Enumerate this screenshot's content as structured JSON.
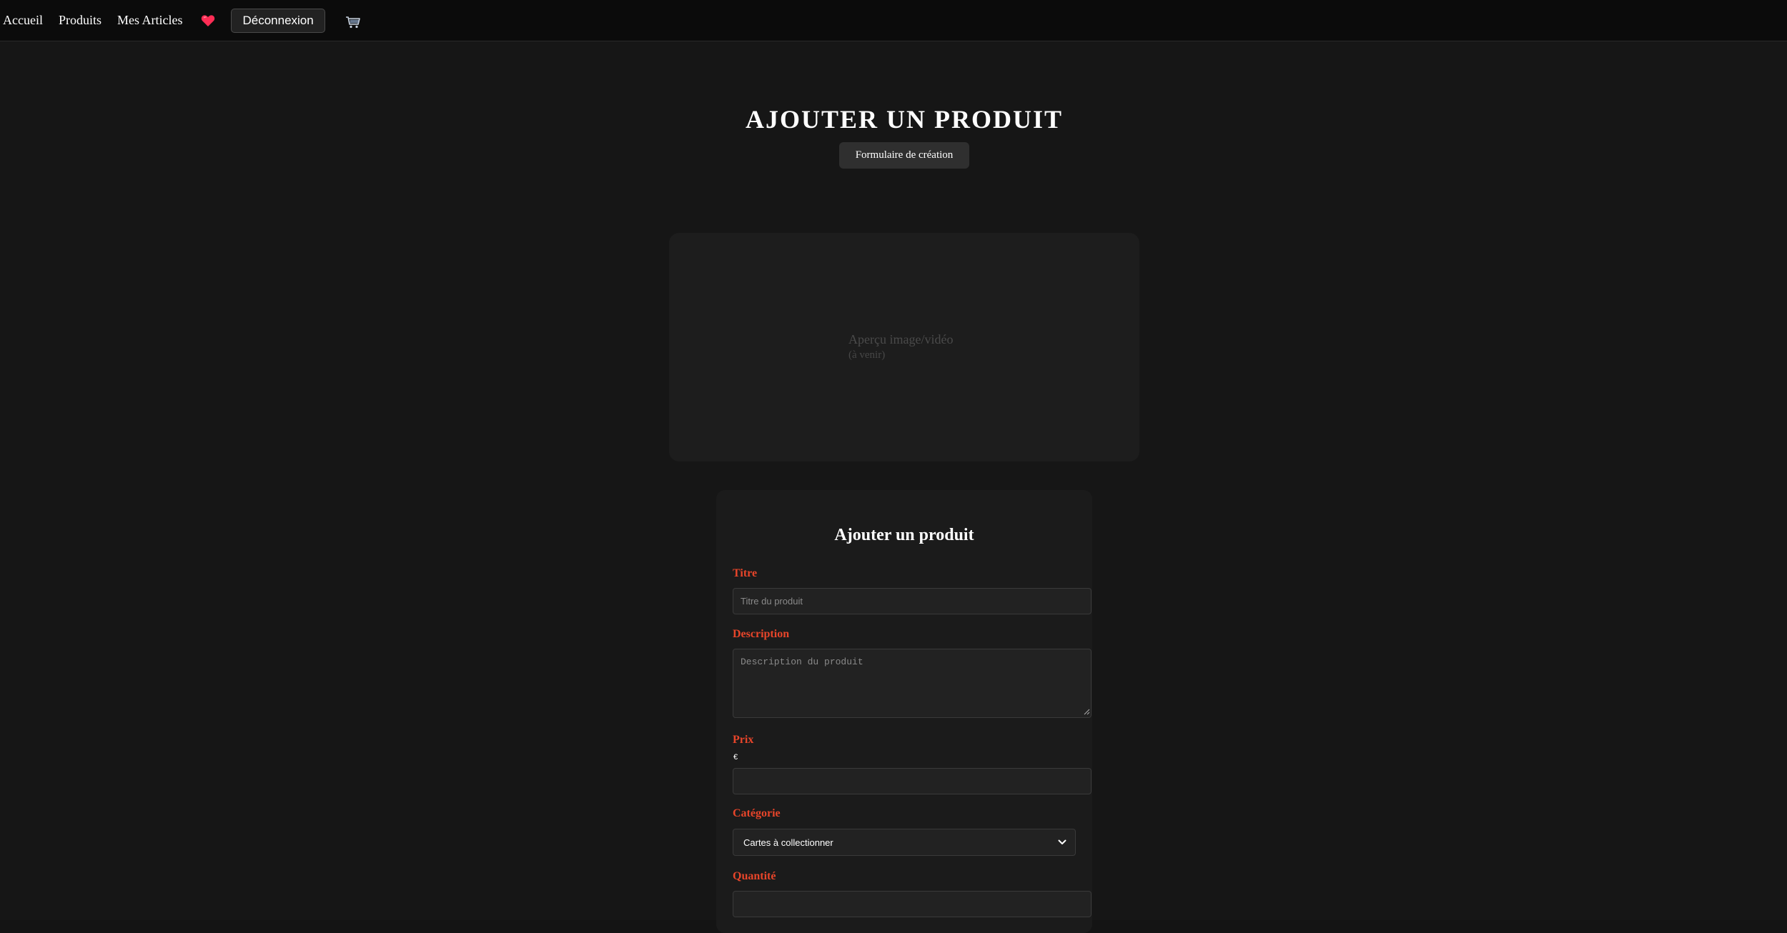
{
  "nav": {
    "home": "Accueil",
    "products": "Produits",
    "my_items": "Mes Articles",
    "logout": "Déconnexion",
    "favorites_icon": "heart-icon",
    "cart_icon": "cart-icon",
    "heart_color": "#ff2d55"
  },
  "header": {
    "title": "AJOUTER UN PRODUIT",
    "subtitle": "Formulaire de création"
  },
  "preview": {
    "text": "Aperçu image/vidéo",
    "subtext": "(à venir)"
  },
  "form": {
    "title": "Ajouter un produit",
    "title_label": "Titre",
    "title_placeholder": "Titre du produit",
    "title_value": "",
    "description_label": "Description",
    "description_placeholder": "Description du produit",
    "description_value": "",
    "price_label": "Prix",
    "price_currency": "€",
    "price_value": "",
    "category_label": "Catégorie",
    "category_selected": "Cartes à collectionner",
    "quantity_label": "Quantité",
    "quantity_value": "",
    "label_color": "#e8452a"
  }
}
